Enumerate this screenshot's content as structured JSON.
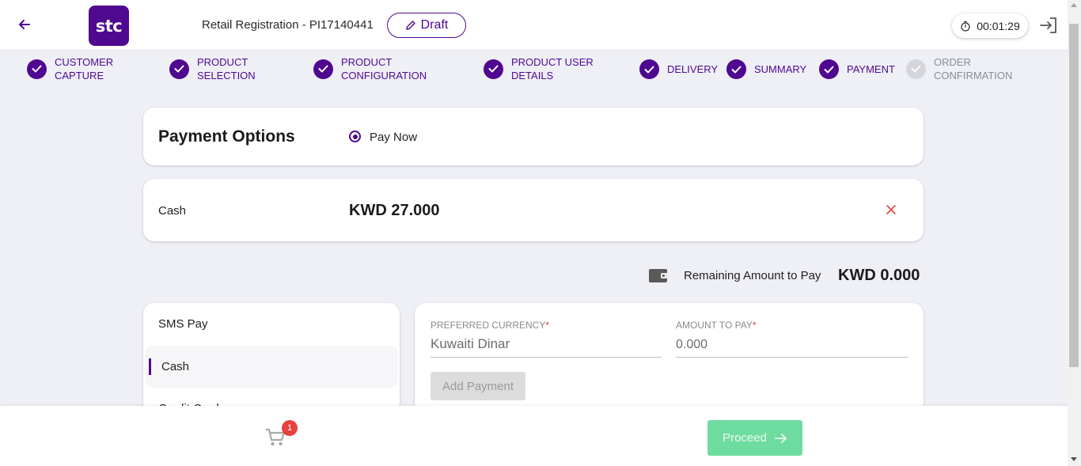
{
  "header": {
    "logo_text": "stc",
    "title": "Retail Registration - PI17140441",
    "draft_label": "Draft",
    "timer": "00:01:29"
  },
  "steps": [
    {
      "label": "CUSTOMER\nCAPTURE",
      "done": true
    },
    {
      "label": "PRODUCT\nSELECTION",
      "done": true
    },
    {
      "label": "PRODUCT\nCONFIGURATION",
      "done": true
    },
    {
      "label": "PRODUCT USER\nDETAILS",
      "done": true
    },
    {
      "label": "DELIVERY",
      "done": true
    },
    {
      "label": "SUMMARY",
      "done": true
    },
    {
      "label": "PAYMENT",
      "done": true
    },
    {
      "label": "ORDER\nCONFIRMATION",
      "done": false
    }
  ],
  "payment_options": {
    "title": "Payment Options",
    "selected_option": "Pay Now"
  },
  "cash_entry": {
    "label": "Cash",
    "amount": "KWD 27.000"
  },
  "remaining": {
    "label": "Remaining Amount to Pay",
    "amount": "KWD 0.000"
  },
  "methods": [
    {
      "label": "SMS Pay",
      "active": false
    },
    {
      "label": "Cash",
      "active": true
    },
    {
      "label": "Credit Card",
      "active": false
    }
  ],
  "form": {
    "currency_label": "PREFERRED CURRENCY",
    "currency_value": "Kuwaiti Dinar",
    "amount_label": "AMOUNT TO PAY",
    "amount_value": "0.000",
    "required_mark": "*",
    "add_payment_label": "Add Payment"
  },
  "footer": {
    "cart_count": "1",
    "proceed_label": "Proceed"
  },
  "colors": {
    "brand": "#4f0890",
    "proceed": "#6fdc9f",
    "badge": "#e5413f",
    "remove": "#e5413f"
  }
}
